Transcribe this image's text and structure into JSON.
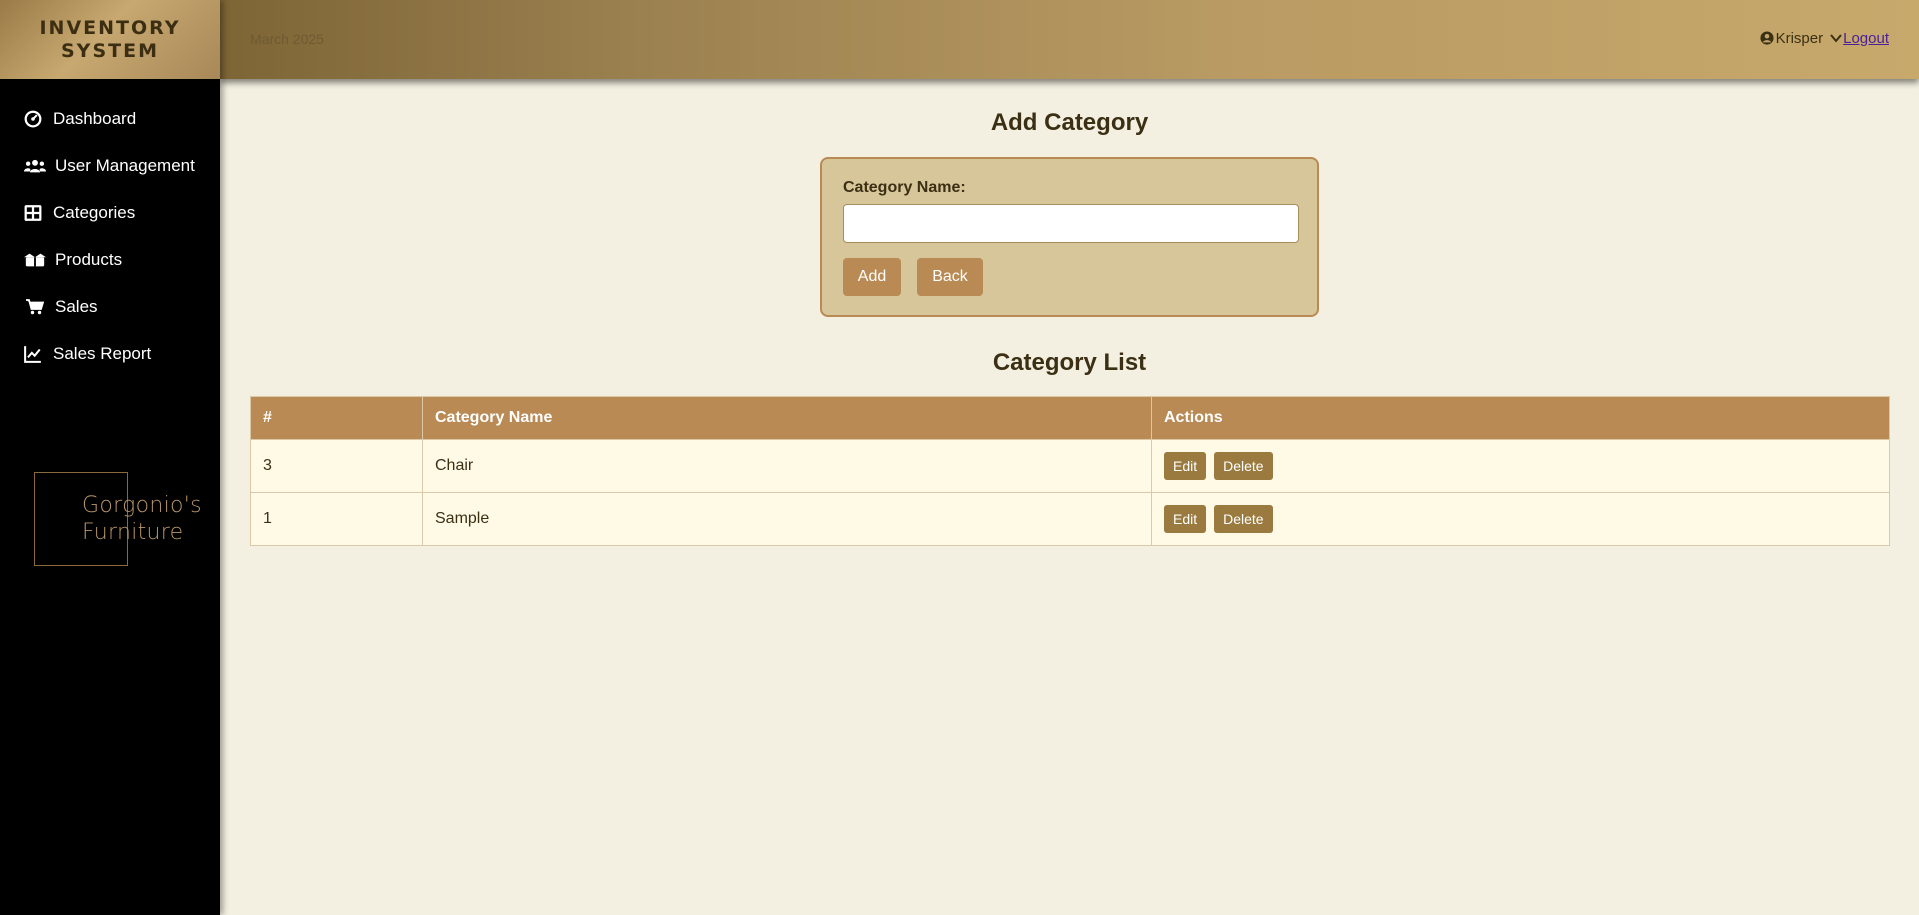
{
  "sidebar": {
    "brand_line1": "INVENTORY",
    "brand_line2": "SYSTEM",
    "items": [
      {
        "label": "Dashboard",
        "icon": "dashboard-icon"
      },
      {
        "label": "User Management",
        "icon": "users-icon"
      },
      {
        "label": "Categories",
        "icon": "grid-icon"
      },
      {
        "label": "Products",
        "icon": "boxes-icon"
      },
      {
        "label": "Sales",
        "icon": "cart-icon"
      },
      {
        "label": "Sales Report",
        "icon": "chart-line-icon"
      }
    ],
    "logo_line1": "Gorgonio's",
    "logo_line2": "Furniture"
  },
  "header": {
    "date_text": "March 2025",
    "username": "Krisper",
    "logout_label": "Logout"
  },
  "form": {
    "title": "Add Category",
    "label": "Category Name:",
    "input_value": "",
    "add_label": "Add",
    "back_label": "Back"
  },
  "list": {
    "title": "Category List",
    "headers": [
      "#",
      "Category Name",
      "Actions"
    ],
    "rows": [
      {
        "num": "3",
        "name": "Chair"
      },
      {
        "num": "1",
        "name": "Sample"
      }
    ],
    "edit_label": "Edit",
    "delete_label": "Delete"
  },
  "colors": {
    "sidebar_bg": "#000000",
    "accent": "#b98a53",
    "page_bg": "#f4f0e1",
    "row_bg": "#fefae6",
    "button_dark": "#9a7a3f"
  }
}
